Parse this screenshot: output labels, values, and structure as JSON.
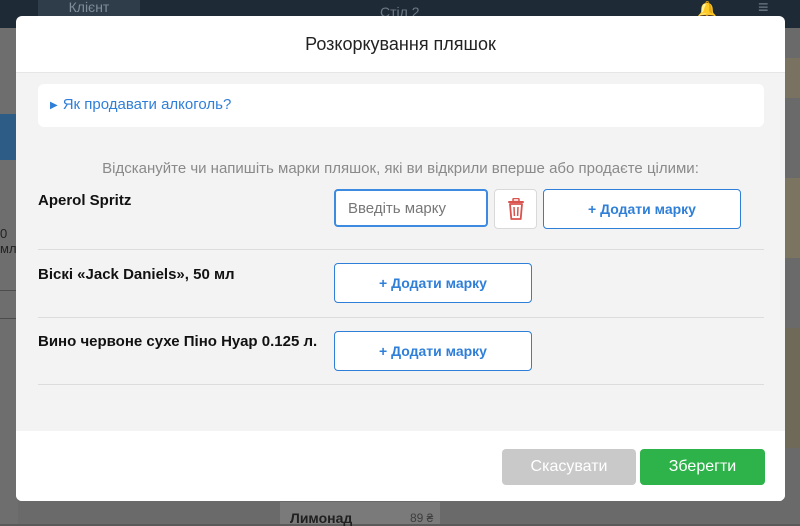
{
  "background": {
    "tab_client": "Клієнт",
    "table_title": "Стіл 2",
    "left_fragment": "0 мл",
    "card_name": "Лимонад",
    "card_price": "89 ₴"
  },
  "modal": {
    "title": "Розкоркування пляшок",
    "info_link": "Як продавати алкоголь?",
    "instructions": "Відскануйте чи напишіть марки пляшок, які ви відкрили вперше або продаєте цілими:",
    "items": [
      {
        "name": "Aperol Spritz",
        "input_placeholder": "Введіть марку",
        "add_label": "+ Додати марку"
      },
      {
        "name": "Віскі «Jack Daniels», 50 мл",
        "add_label": "+ Додати марку"
      },
      {
        "name": "Вино червоне сухе Піно Нуар 0.125 л.",
        "add_label": "+ Додати марку"
      }
    ],
    "cancel_label": "Скасувати",
    "save_label": "Зберегти"
  },
  "colors": {
    "accent": "#2f7fd8",
    "save": "#2eb34a",
    "cancel": "#c9c9c9",
    "delete": "#d9534f"
  }
}
